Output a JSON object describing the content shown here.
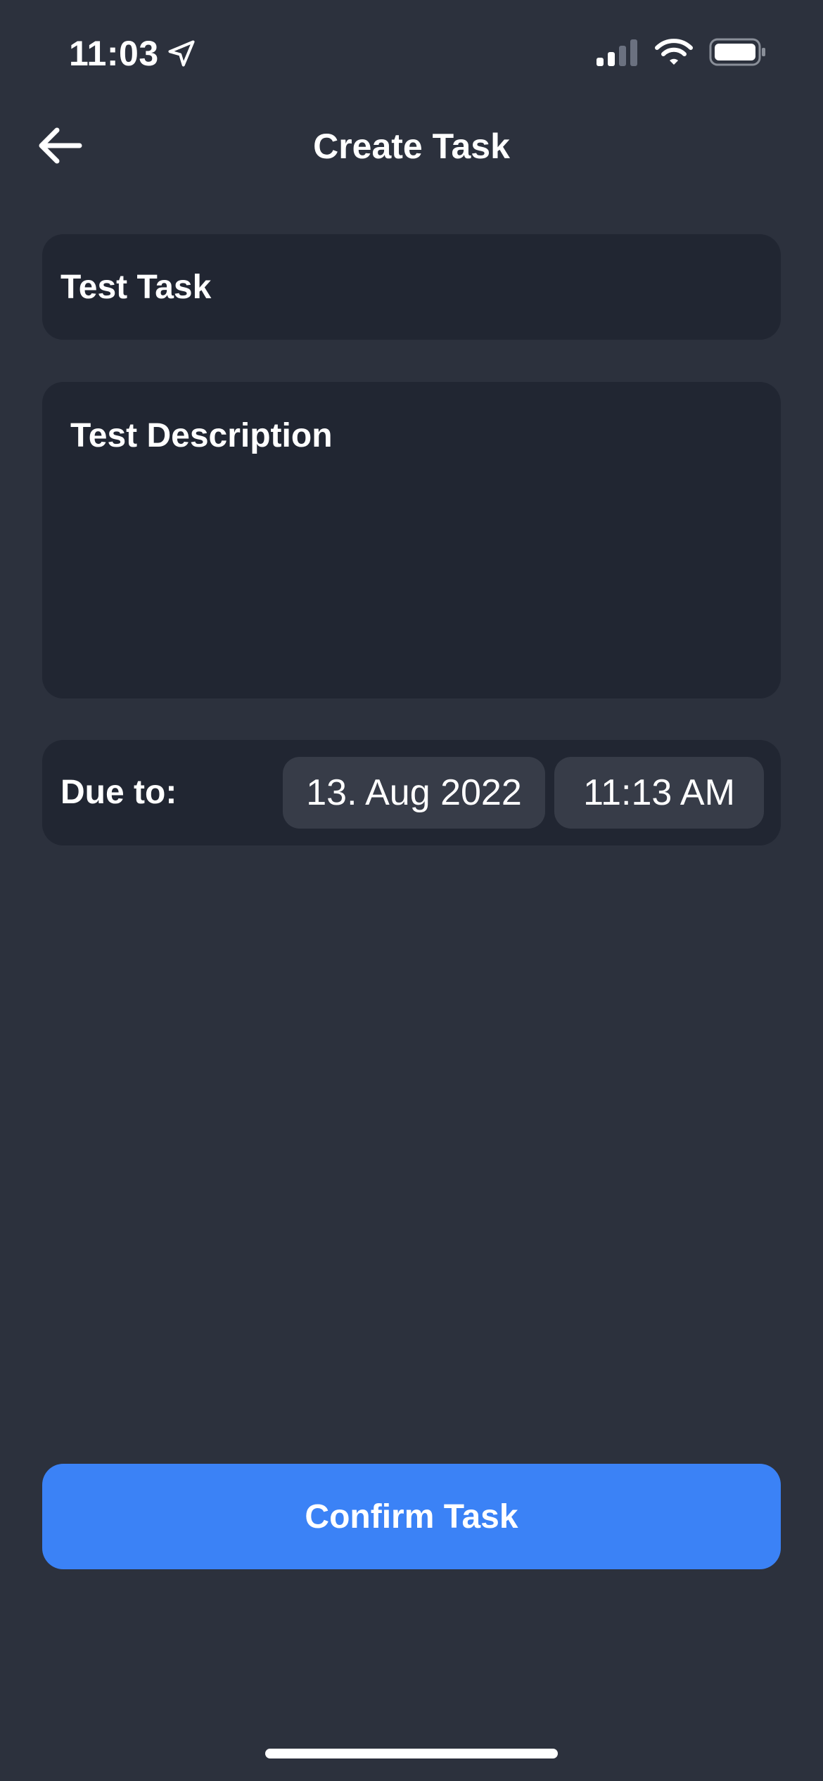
{
  "status_bar": {
    "time": "11:03",
    "location_icon": "location-arrow-icon",
    "signal_icon": "cellular-signal-icon",
    "wifi_icon": "wifi-icon",
    "battery_icon": "battery-icon"
  },
  "nav": {
    "back_icon": "arrow-left-icon",
    "title": "Create Task"
  },
  "form": {
    "title_value": "Test Task",
    "description_value": "Test Description",
    "due_label": "Due to:",
    "due_date": "13. Aug 2022",
    "due_time": "11:13 AM"
  },
  "actions": {
    "confirm_label": "Confirm Task"
  },
  "colors": {
    "background": "#2c313d",
    "field_background": "#212632",
    "pill_background": "#373c48",
    "accent": "#3b82f6",
    "text": "#ffffff"
  }
}
